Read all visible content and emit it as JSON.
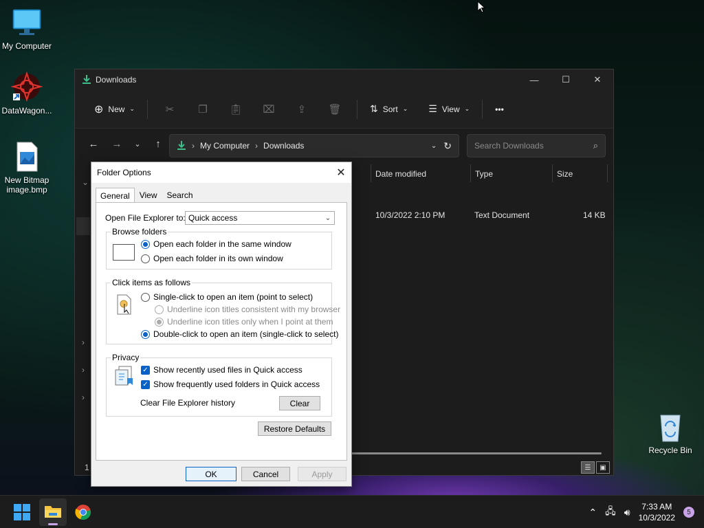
{
  "desktop": {
    "icons": [
      {
        "label": "My Computer"
      },
      {
        "label": "DataWagon..."
      },
      {
        "label": "New Bitmap image.bmp"
      },
      {
        "label": "Recycle Bin"
      }
    ]
  },
  "explorer": {
    "title": "Downloads",
    "toolbar": {
      "new_label": "New",
      "sort_label": "Sort",
      "view_label": "View",
      "more_label": "•••"
    },
    "address": {
      "root": "My Computer",
      "current": "Downloads"
    },
    "search_placeholder": "Search Downloads",
    "columns": [
      "Date modified",
      "Type",
      "Size"
    ],
    "rows": [
      {
        "date": "10/3/2022 2:10 PM",
        "type": "Text Document",
        "size": "14 KB"
      }
    ],
    "status": "1"
  },
  "dialog": {
    "title": "Folder Options",
    "tabs": [
      "General",
      "View",
      "Search"
    ],
    "open_to_label": "Open File Explorer to:",
    "open_to_value": "Quick access",
    "browse": {
      "legend": "Browse folders",
      "options": [
        "Open each folder in the same window",
        "Open each folder in its own window"
      ],
      "selected": 0
    },
    "click": {
      "legend": "Click items as follows",
      "single": "Single-click to open an item (point to select)",
      "underline_browser": "Underline icon titles consistent with my browser",
      "underline_point": "Underline icon titles only when I point at them",
      "double": "Double-click to open an item (single-click to select)"
    },
    "privacy": {
      "legend": "Privacy",
      "recent_files": "Show recently used files in Quick access",
      "frequent_folders": "Show frequently used folders in Quick access",
      "clear_label": "Clear File Explorer history",
      "clear_button": "Clear"
    },
    "restore_defaults": "Restore Defaults",
    "ok": "OK",
    "cancel": "Cancel",
    "apply": "Apply"
  },
  "taskbar": {
    "time": "7:33 AM",
    "date": "10/3/2022",
    "notifications": "5"
  }
}
